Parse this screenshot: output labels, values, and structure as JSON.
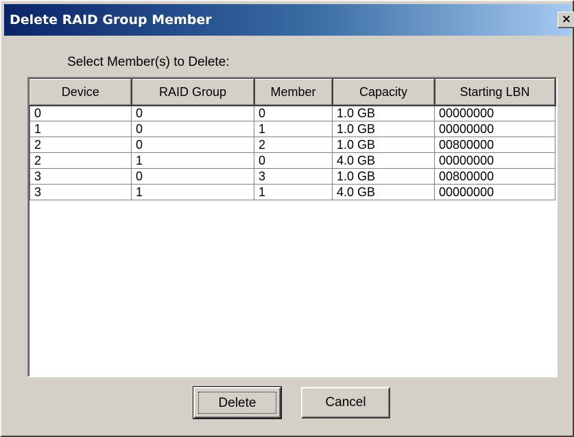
{
  "window": {
    "title": "Delete RAID Group Member",
    "close_label": "×"
  },
  "instruction": "Select Member(s) to Delete:",
  "table": {
    "columns": [
      "Device",
      "RAID Group",
      "Member",
      "Capacity",
      "Starting LBN"
    ],
    "rows": [
      [
        "0",
        "0",
        "0",
        "1.0 GB",
        "00000000"
      ],
      [
        "1",
        "0",
        "1",
        "1.0 GB",
        "00000000"
      ],
      [
        "2",
        "0",
        "2",
        "1.0 GB",
        "00800000"
      ],
      [
        "2",
        "1",
        "0",
        "4.0 GB",
        "00000000"
      ],
      [
        "3",
        "0",
        "3",
        "1.0 GB",
        "00800000"
      ],
      [
        "3",
        "1",
        "1",
        "4.0 GB",
        "00000000"
      ]
    ]
  },
  "buttons": {
    "delete_label": "Delete",
    "cancel_label": "Cancel"
  },
  "colors": {
    "titlebar_start": "#0a246a",
    "titlebar_end": "#a6caf0",
    "dialog_face": "#d4d0c8"
  }
}
